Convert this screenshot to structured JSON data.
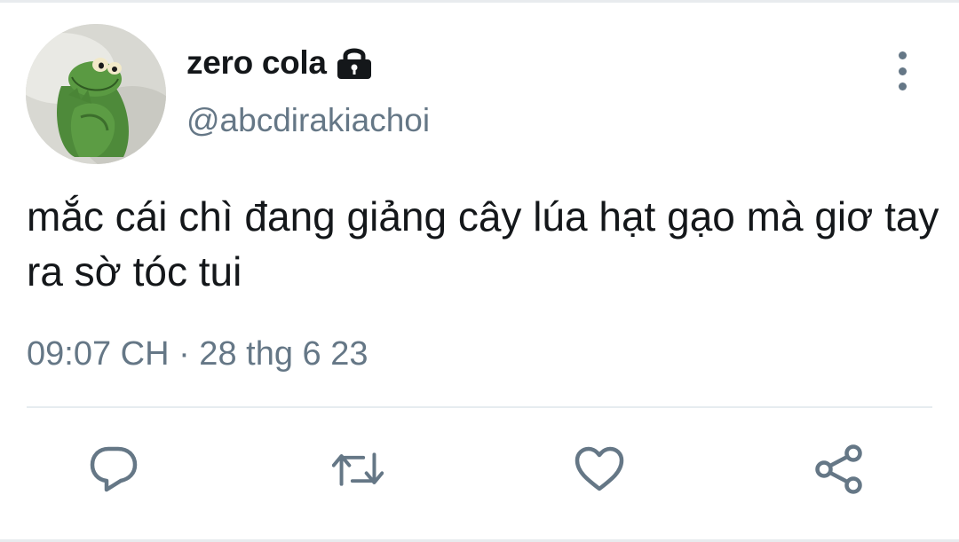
{
  "tweet": {
    "display_name": "zero cola",
    "handle": "@abcdirakiachoi",
    "text": "mắc cái chì đang giảng cây lúa hạt gạo mà giơ tay ra sờ tóc tui",
    "timestamp": "09:07 CH · 28 thg 6 23",
    "protected": true
  },
  "icons": {
    "lock": "lock-icon",
    "more": "more-vertical-icon",
    "reply": "reply-icon",
    "retweet": "retweet-icon",
    "like": "heart-icon",
    "share": "share-icon"
  },
  "colors": {
    "text_primary": "#14171a",
    "text_secondary": "#657786",
    "divider": "#e6ecf0",
    "avatar_green": "#4e8a3a"
  }
}
